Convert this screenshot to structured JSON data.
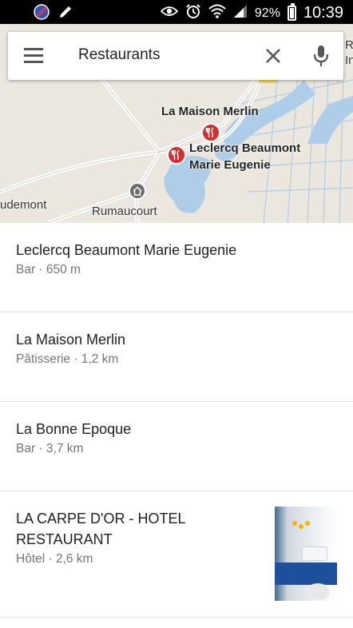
{
  "status_bar": {
    "battery": "92%",
    "time": "10:39"
  },
  "search": {
    "query": "Restaurants"
  },
  "map": {
    "labels": {
      "la_maison_merlin": "La Maison Merlin",
      "leclercq_line1": "Leclercq Beaumont",
      "leclercq_line2": "Marie Eugenie",
      "rumaucourt": "Rumaucourt",
      "udemont": "udemont",
      "edge_line1": "RP",
      "edge_line2": "In"
    }
  },
  "results": [
    {
      "title": "Leclercq Beaumont Marie Eugenie",
      "subtitle": "Bar · 650 m"
    },
    {
      "title": "La Maison Merlin",
      "subtitle": "Pâtisserie · 1,2 km"
    },
    {
      "title": "La Bonne Epoque",
      "subtitle": "Bar · 3,7 km"
    },
    {
      "title_line1": "LA CARPE D'OR - HOTEL",
      "title_line2": "RESTAURANT",
      "subtitle": "Hôtel · 2,6 km"
    }
  ]
}
